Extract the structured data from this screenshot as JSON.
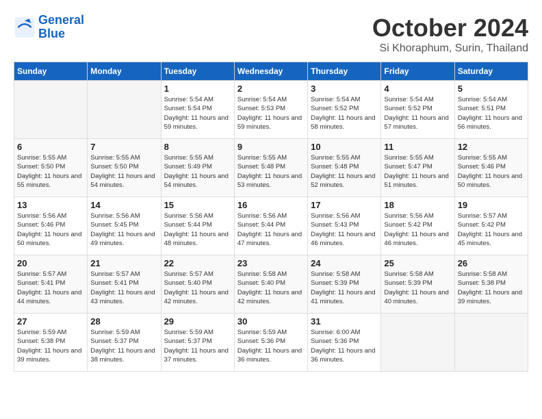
{
  "header": {
    "logo_line1": "General",
    "logo_line2": "Blue",
    "month": "October 2024",
    "location": "Si Khoraphum, Surin, Thailand"
  },
  "columns": [
    "Sunday",
    "Monday",
    "Tuesday",
    "Wednesday",
    "Thursday",
    "Friday",
    "Saturday"
  ],
  "weeks": [
    [
      {
        "day": "",
        "info": ""
      },
      {
        "day": "",
        "info": ""
      },
      {
        "day": "1",
        "info": "Sunrise: 5:54 AM\nSunset: 5:54 PM\nDaylight: 11 hours and 59 minutes."
      },
      {
        "day": "2",
        "info": "Sunrise: 5:54 AM\nSunset: 5:53 PM\nDaylight: 11 hours and 59 minutes."
      },
      {
        "day": "3",
        "info": "Sunrise: 5:54 AM\nSunset: 5:52 PM\nDaylight: 11 hours and 58 minutes."
      },
      {
        "day": "4",
        "info": "Sunrise: 5:54 AM\nSunset: 5:52 PM\nDaylight: 11 hours and 57 minutes."
      },
      {
        "day": "5",
        "info": "Sunrise: 5:54 AM\nSunset: 5:51 PM\nDaylight: 11 hours and 56 minutes."
      }
    ],
    [
      {
        "day": "6",
        "info": "Sunrise: 5:55 AM\nSunset: 5:50 PM\nDaylight: 11 hours and 55 minutes."
      },
      {
        "day": "7",
        "info": "Sunrise: 5:55 AM\nSunset: 5:50 PM\nDaylight: 11 hours and 54 minutes."
      },
      {
        "day": "8",
        "info": "Sunrise: 5:55 AM\nSunset: 5:49 PM\nDaylight: 11 hours and 54 minutes."
      },
      {
        "day": "9",
        "info": "Sunrise: 5:55 AM\nSunset: 5:48 PM\nDaylight: 11 hours and 53 minutes."
      },
      {
        "day": "10",
        "info": "Sunrise: 5:55 AM\nSunset: 5:48 PM\nDaylight: 11 hours and 52 minutes."
      },
      {
        "day": "11",
        "info": "Sunrise: 5:55 AM\nSunset: 5:47 PM\nDaylight: 11 hours and 51 minutes."
      },
      {
        "day": "12",
        "info": "Sunrise: 5:55 AM\nSunset: 5:46 PM\nDaylight: 11 hours and 50 minutes."
      }
    ],
    [
      {
        "day": "13",
        "info": "Sunrise: 5:56 AM\nSunset: 5:46 PM\nDaylight: 11 hours and 50 minutes."
      },
      {
        "day": "14",
        "info": "Sunrise: 5:56 AM\nSunset: 5:45 PM\nDaylight: 11 hours and 49 minutes."
      },
      {
        "day": "15",
        "info": "Sunrise: 5:56 AM\nSunset: 5:44 PM\nDaylight: 11 hours and 48 minutes."
      },
      {
        "day": "16",
        "info": "Sunrise: 5:56 AM\nSunset: 5:44 PM\nDaylight: 11 hours and 47 minutes."
      },
      {
        "day": "17",
        "info": "Sunrise: 5:56 AM\nSunset: 5:43 PM\nDaylight: 11 hours and 46 minutes."
      },
      {
        "day": "18",
        "info": "Sunrise: 5:56 AM\nSunset: 5:42 PM\nDaylight: 11 hours and 46 minutes."
      },
      {
        "day": "19",
        "info": "Sunrise: 5:57 AM\nSunset: 5:42 PM\nDaylight: 11 hours and 45 minutes."
      }
    ],
    [
      {
        "day": "20",
        "info": "Sunrise: 5:57 AM\nSunset: 5:41 PM\nDaylight: 11 hours and 44 minutes."
      },
      {
        "day": "21",
        "info": "Sunrise: 5:57 AM\nSunset: 5:41 PM\nDaylight: 11 hours and 43 minutes."
      },
      {
        "day": "22",
        "info": "Sunrise: 5:57 AM\nSunset: 5:40 PM\nDaylight: 11 hours and 42 minutes."
      },
      {
        "day": "23",
        "info": "Sunrise: 5:58 AM\nSunset: 5:40 PM\nDaylight: 11 hours and 42 minutes."
      },
      {
        "day": "24",
        "info": "Sunrise: 5:58 AM\nSunset: 5:39 PM\nDaylight: 11 hours and 41 minutes."
      },
      {
        "day": "25",
        "info": "Sunrise: 5:58 AM\nSunset: 5:39 PM\nDaylight: 11 hours and 40 minutes."
      },
      {
        "day": "26",
        "info": "Sunrise: 5:58 AM\nSunset: 5:38 PM\nDaylight: 11 hours and 39 minutes."
      }
    ],
    [
      {
        "day": "27",
        "info": "Sunrise: 5:59 AM\nSunset: 5:38 PM\nDaylight: 11 hours and 39 minutes."
      },
      {
        "day": "28",
        "info": "Sunrise: 5:59 AM\nSunset: 5:37 PM\nDaylight: 11 hours and 38 minutes."
      },
      {
        "day": "29",
        "info": "Sunrise: 5:59 AM\nSunset: 5:37 PM\nDaylight: 11 hours and 37 minutes."
      },
      {
        "day": "30",
        "info": "Sunrise: 5:59 AM\nSunset: 5:36 PM\nDaylight: 11 hours and 36 minutes."
      },
      {
        "day": "31",
        "info": "Sunrise: 6:00 AM\nSunset: 5:36 PM\nDaylight: 11 hours and 36 minutes."
      },
      {
        "day": "",
        "info": ""
      },
      {
        "day": "",
        "info": ""
      }
    ]
  ]
}
